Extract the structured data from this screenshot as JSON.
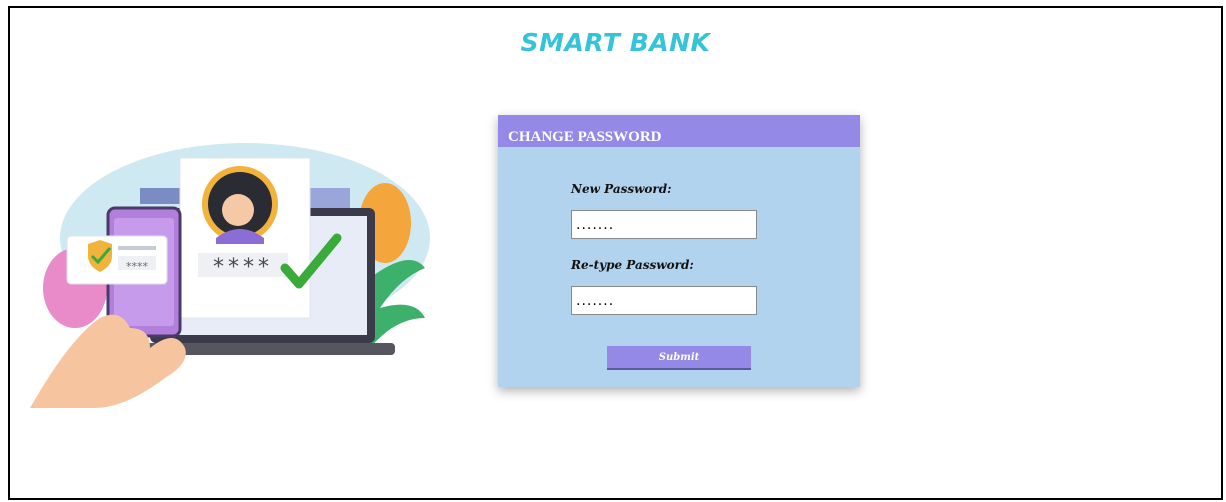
{
  "brand": {
    "title": "SMART BANK"
  },
  "illustration": {
    "pin_large": "****",
    "pin_small": "****"
  },
  "form": {
    "header": "CHANGE PASSWORD",
    "new_password": {
      "label": "New Password:",
      "value": "......."
    },
    "retype_password": {
      "label": "Re-type Password:",
      "value": "......."
    },
    "submit_label": "Submit"
  },
  "colors": {
    "brand": "#33c4d8",
    "card_header": "#9489e6",
    "card_body": "#b2d3ee",
    "submit": "#9489e6"
  }
}
